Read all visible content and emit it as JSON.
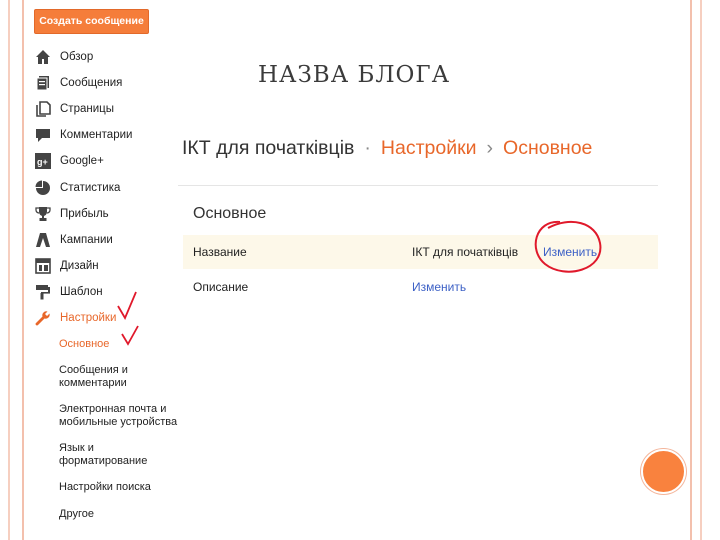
{
  "slide": {
    "heading": "НАЗВА БЛОГА",
    "accent_color": "#f9823e",
    "frame_color": "#f3c0ad"
  },
  "sidebar": {
    "create_button": "Создать сообщение",
    "items": [
      {
        "label": "Обзор",
        "icon": "home-icon"
      },
      {
        "label": "Сообщения",
        "icon": "posts-icon"
      },
      {
        "label": "Страницы",
        "icon": "pages-icon"
      },
      {
        "label": "Комментарии",
        "icon": "comment-icon"
      },
      {
        "label": "Google+",
        "icon": "google-plus-icon"
      },
      {
        "label": "Статистика",
        "icon": "stats-icon"
      },
      {
        "label": "Прибыль",
        "icon": "trophy-icon"
      },
      {
        "label": "Кампании",
        "icon": "campaigns-icon"
      },
      {
        "label": "Дизайн",
        "icon": "layout-icon"
      },
      {
        "label": "Шаблон",
        "icon": "template-icon"
      },
      {
        "label": "Настройки",
        "icon": "wrench-icon",
        "active": true
      }
    ],
    "sub_items": [
      {
        "label": "Основное",
        "active": true
      },
      {
        "label": "Сообщения и комментарии"
      },
      {
        "label": "Электронная почта и мобильные устройства"
      },
      {
        "label": "Язык и форматирование"
      },
      {
        "label": "Настройки поиска"
      },
      {
        "label": "Другое"
      }
    ]
  },
  "main": {
    "breadcrumb": {
      "blog": "ІКТ для початківців",
      "sep1": "·",
      "settings": "Настройки",
      "sep2": "›",
      "current": "Основное"
    },
    "section_title": "Основное",
    "rows": [
      {
        "label": "Название",
        "value": "ІКТ для початківців",
        "link": "Изменить"
      },
      {
        "label": "Описание",
        "value": "",
        "link": "Изменить"
      }
    ]
  },
  "annotation_color": "#e0192b"
}
